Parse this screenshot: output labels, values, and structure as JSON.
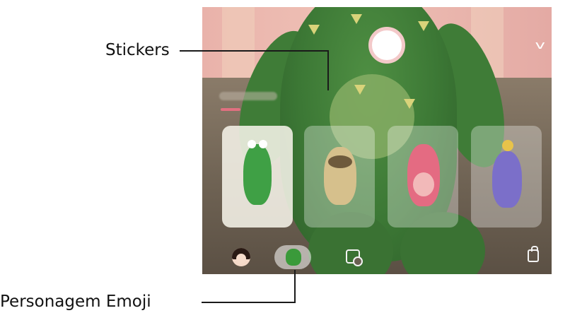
{
  "callouts": {
    "stickers": "Stickers",
    "emoji_character": "Personagem Emoji"
  },
  "screen": {
    "characters": [
      {
        "icon": "dinosaur-character",
        "color": "#3fa045",
        "selected": true
      },
      {
        "icon": "sloth-character",
        "color": "#d6c08c",
        "selected": false
      },
      {
        "icon": "pink-character",
        "color": "#e46b82",
        "selected": false
      },
      {
        "icon": "bird-character",
        "color": "#7b6fc9",
        "selected": false
      }
    ],
    "bottom_bar": {
      "avatar": "avatar-icon",
      "emoji_character_tab": "dinosaur-icon",
      "stickers": "sticker-settings-icon",
      "store": "shopping-bag-icon"
    },
    "collapse": "chevron-down-icon"
  },
  "colors": {
    "accent": "#e07080",
    "callout_line": "#1a1a1a"
  }
}
